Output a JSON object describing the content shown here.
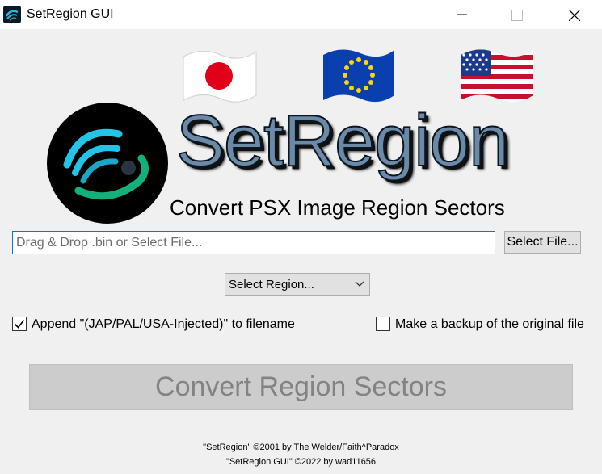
{
  "window": {
    "title": "SetRegion GUI"
  },
  "branding": {
    "title": "SetRegion",
    "subtitle": "Convert PSX Image Region Sectors"
  },
  "file": {
    "placeholder": "Drag & Drop .bin or Select File...",
    "value": "",
    "select_button": "Select File..."
  },
  "region_select": {
    "selected": "Select Region..."
  },
  "options": {
    "append_label": "Append \"(JAP/PAL/USA-Injected)\" to filename",
    "append_checked": true,
    "backup_label": "Make a backup of the original file",
    "backup_checked": false
  },
  "convert_button": "Convert Region Sectors",
  "credits": [
    "\"SetRegion\" ©2001 by The Welder/Faith^Paradox",
    "\"SetRegion GUI\" ©2022 by wad11656"
  ],
  "icons": [
    "app-icon",
    "minimize-icon",
    "maximize-icon",
    "close-icon",
    "japan-flag-icon",
    "eu-flag-icon",
    "usa-flag-icon",
    "logo-swirl-icon",
    "chevron-down-icon",
    "checkmark-icon"
  ],
  "colors": {
    "accent": "#0078d7",
    "background": "#f0f0f0",
    "brand_text": "#6b8aa8",
    "disabled_button": "#cccccc"
  }
}
